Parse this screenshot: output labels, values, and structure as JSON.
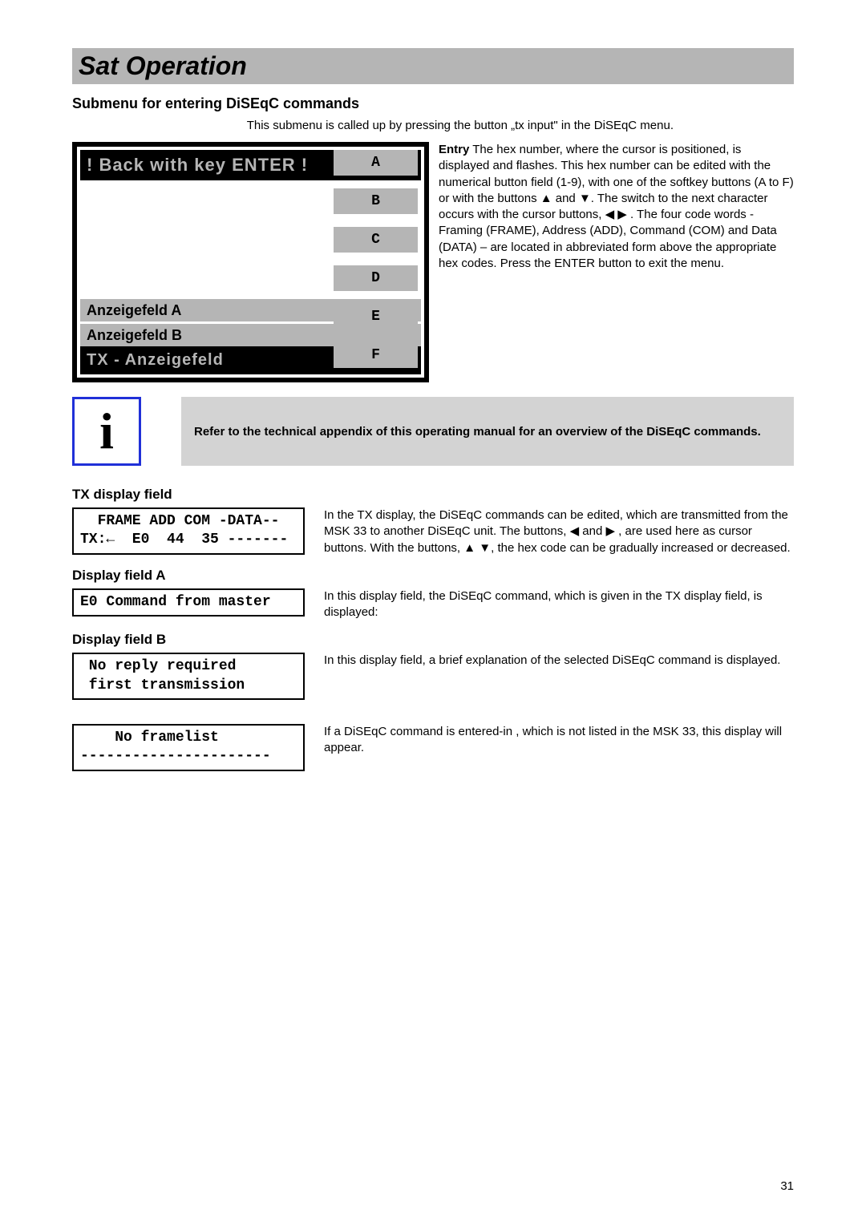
{
  "title": "Sat Operation",
  "subtitle": "Submenu for entering DiSEqC commands",
  "intro": "This submenu is called up by pressing the button „tx input\" in the DiSEqC menu.",
  "screen": {
    "banner": "!  Back with key ENTER !",
    "rowA": "Anzeigefeld A",
    "rowB": "Anzeigefeld B",
    "txRow": "TX - Anzeigefeld",
    "softkeys": [
      "A",
      "B",
      "C",
      "D",
      "E",
      "F"
    ]
  },
  "entry": {
    "label": "Entry",
    "text": "The hex number, where the cursor is positioned, is displayed and flashes. This hex number can be edited with the numerical button field (1-9), with one of the softkey buttons (A to F) or with the buttons ▲ and ▼. The switch to the next character occurs with the cursor buttons, ◀ ▶ . The four code words - Framing (FRAME), Address (ADD), Command (COM) and Data (DATA) – are located in abbreviated form above the appropriate hex codes. Press the ENTER button to exit the menu."
  },
  "info": {
    "iconGlyph": "i",
    "text": "Refer to the technical appendix of this operating manual for an overview of the DiSEqC commands."
  },
  "txField": {
    "header": "TX display field",
    "box": "  FRAME ADD COM -DATA--\nTX:←  E0  44  35 -------",
    "desc": "In the TX display, the DiSEqC commands can be edited, which are transmitted from the MSK 33 to another DiSEqC unit. The buttons, ◀ and ▶ ,  are used here as cursor buttons. With the buttons, ▲ ▼, the hex code can be gradually increased or decreased."
  },
  "fieldA": {
    "header": "Display field A",
    "box": "E0 Command from master",
    "desc": "In this display field, the DiSEqC command, which is given in the TX display field, is displayed:"
  },
  "fieldB": {
    "header": "Display field B",
    "box": " No reply required\n first transmission",
    "desc": "In this display field, a brief explanation of the selected DiSEqC command is displayed."
  },
  "noframe": {
    "box": "    No framelist\n----------------------",
    "desc": "If a DiSEqC command is entered-in , which is not listed in the MSK 33, this display will appear."
  },
  "pageNumber": "31"
}
